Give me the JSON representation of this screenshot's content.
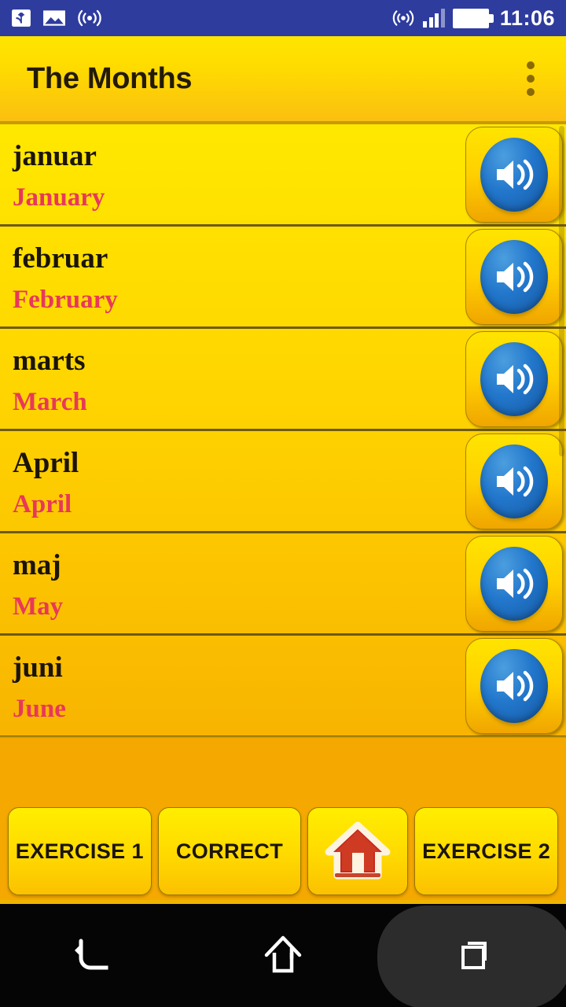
{
  "statusbar": {
    "time": "11:06",
    "left_icons": [
      "cast-icon",
      "image-icon",
      "wifi-hotspot-icon"
    ],
    "right_icons": [
      "hotspot-icon",
      "signal-bars-icon",
      "battery-full-icon"
    ],
    "background_color": "#2E3C9E"
  },
  "titlebar": {
    "title": "The Months",
    "overflow_menu": "overflow-menu-icon",
    "background_top": "#FFE500",
    "background_bottom": "#FBBF10"
  },
  "list": {
    "rows": [
      {
        "native": "januar",
        "translation": "January",
        "speaker": "speaker-icon"
      },
      {
        "native": "februar",
        "translation": "February",
        "speaker": "speaker-icon"
      },
      {
        "native": "marts",
        "translation": "March",
        "speaker": "speaker-icon"
      },
      {
        "native": "April",
        "translation": "April",
        "speaker": "speaker-icon"
      },
      {
        "native": "maj",
        "translation": "May",
        "speaker": "speaker-icon"
      },
      {
        "native": "juni",
        "translation": "June",
        "speaker": "speaker-icon"
      }
    ],
    "native_color": "#1b1408",
    "translation_color": "#E8385A"
  },
  "buttons": [
    {
      "label": "EXERCISE 1",
      "name": "exercise-1-button"
    },
    {
      "label": "CORRECT",
      "name": "correct-button"
    },
    {
      "label": "",
      "name": "home-button",
      "icon": "house-icon"
    },
    {
      "label": "EXERCISE 2",
      "name": "exercise-2-button"
    }
  ],
  "navbar": {
    "back": "back-icon",
    "home": "home-icon",
    "recents": "recents-icon"
  }
}
